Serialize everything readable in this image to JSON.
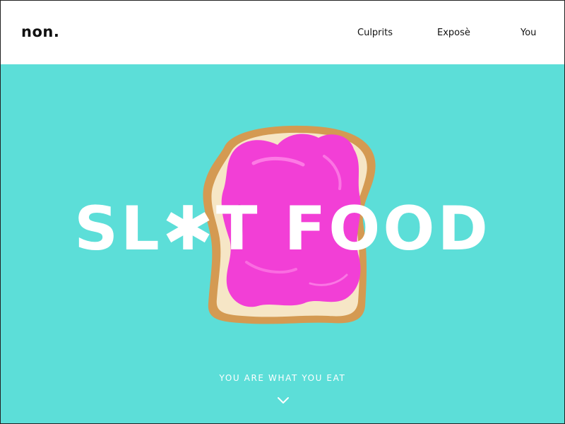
{
  "header": {
    "logo": "non.",
    "nav": [
      "Culprits",
      "Exposè",
      "You"
    ]
  },
  "hero": {
    "headline": "SL✱T FOOD",
    "tagline": "YOU ARE WHAT YOU EAT",
    "scroll_icon": "chevron-down-icon"
  },
  "colors": {
    "hero_background": "#5cded8",
    "spread": "#f23fd6",
    "crust": "#d49a52",
    "bread": "#f6e6c6",
    "text_on_hero": "#ffffff"
  }
}
